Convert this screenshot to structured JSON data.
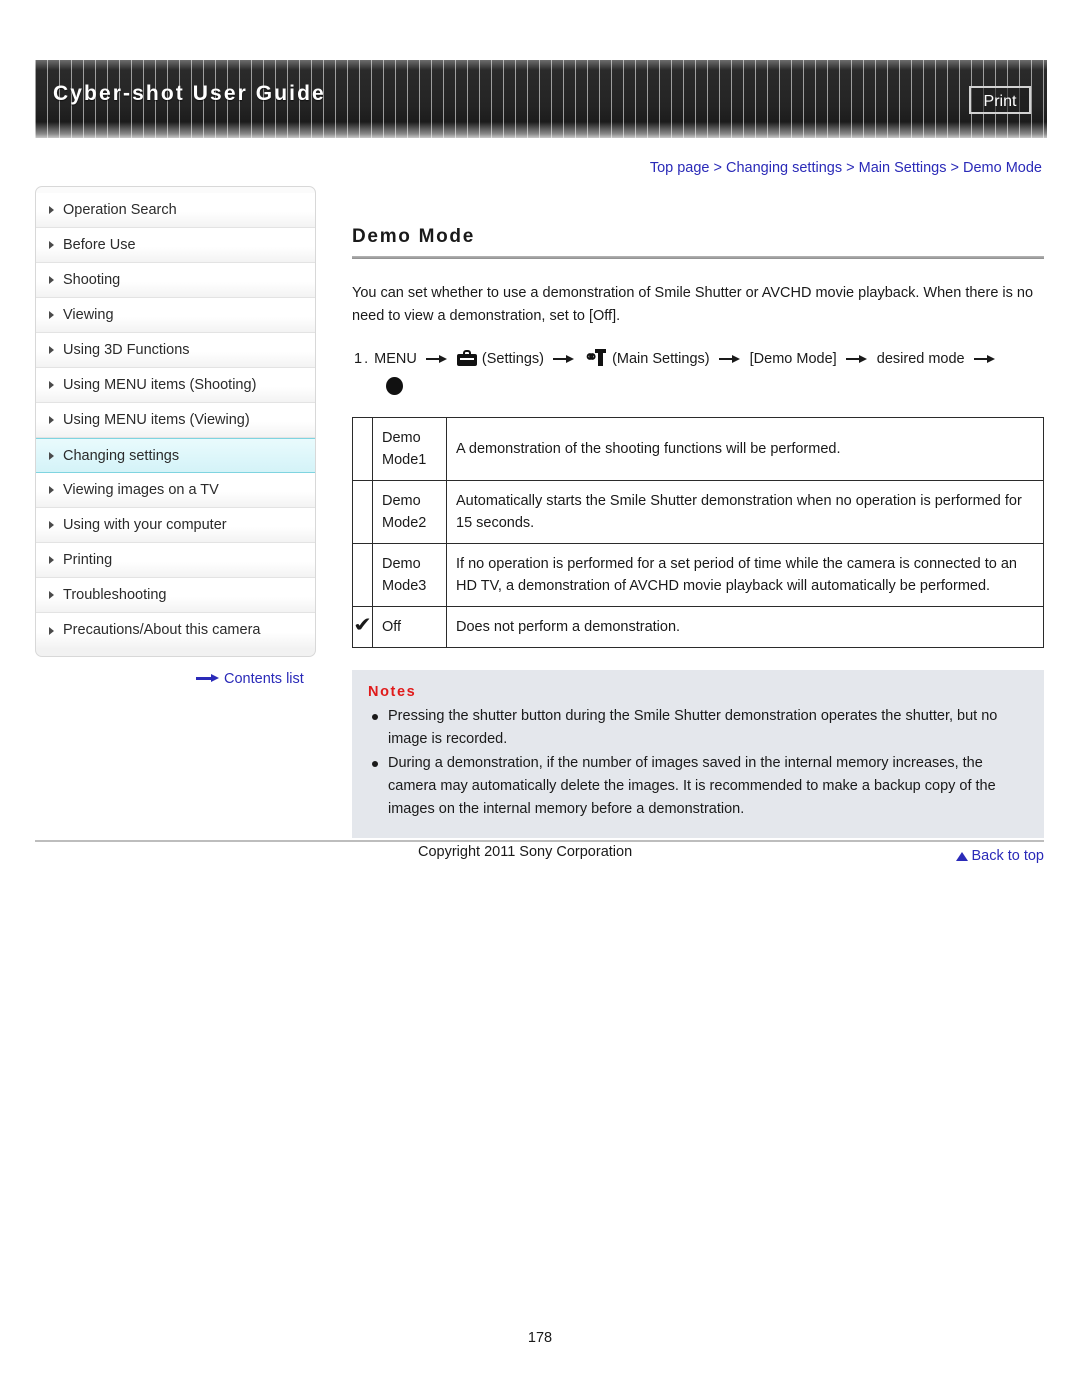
{
  "header": {
    "title": "Cyber-shot User Guide",
    "print_label": "Print"
  },
  "sidebar": {
    "items": [
      {
        "label": "Operation Search",
        "active": false
      },
      {
        "label": "Before Use",
        "active": false
      },
      {
        "label": "Shooting",
        "active": false
      },
      {
        "label": "Viewing",
        "active": false
      },
      {
        "label": "Using 3D Functions",
        "active": false
      },
      {
        "label": "Using MENU items (Shooting)",
        "active": false
      },
      {
        "label": "Using MENU items (Viewing)",
        "active": false
      },
      {
        "label": "Changing settings",
        "active": true
      },
      {
        "label": "Viewing images on a TV",
        "active": false
      },
      {
        "label": "Using with your computer",
        "active": false
      },
      {
        "label": "Printing",
        "active": false
      },
      {
        "label": "Troubleshooting",
        "active": false
      },
      {
        "label": "Precautions/About this camera",
        "active": false
      }
    ],
    "contents_list_label": "Contents list"
  },
  "breadcrumb": {
    "items": [
      "Top page",
      "Changing settings",
      "Main Settings",
      "Demo Mode"
    ],
    "separator": ">"
  },
  "main": {
    "title": "Demo Mode",
    "intro": "You can set whether to use a demonstration of Smile Shutter or AVCHD movie playback. When there is no need to view a demonstration, set to [Off].",
    "step": {
      "number": "1.",
      "menu": "MENU",
      "settings_label": "(Settings)",
      "main_settings_label": "(Main Settings)",
      "demo_mode_label": "[Demo Mode]",
      "desired_mode_label": "desired mode"
    },
    "table": {
      "rows": [
        {
          "checked": false,
          "check": "",
          "label": "Demo\nMode1",
          "description": "A demonstration of the shooting functions will be performed."
        },
        {
          "checked": false,
          "check": "",
          "label": "Demo\nMode2",
          "description": "Automatically starts the Smile Shutter demonstration when no operation is performed for 15 seconds."
        },
        {
          "checked": false,
          "check": "",
          "label": "Demo\nMode3",
          "description": "If no operation is performed for a set period of time while the camera is connected to an HD TV, a demonstration of AVCHD movie playback will automatically be performed."
        },
        {
          "checked": true,
          "check": "✔",
          "label": "Off",
          "description": "Does not perform a demonstration."
        }
      ]
    },
    "notes": {
      "title": "Notes",
      "items": [
        "Pressing the shutter button during the Smile Shutter demonstration operates the shutter, but no image is recorded.",
        "During a demonstration, if the number of images saved in the internal memory increases, the camera may automatically delete the images. It is recommended to make a backup copy of the images on the internal memory before a demonstration."
      ]
    }
  },
  "footer": {
    "back_to_top": "Back to top",
    "copyright": "Copyright 2011 Sony Corporation",
    "page_number": "178"
  },
  "colors": {
    "link": "#2a2ab8",
    "notes_title": "#e01b1b",
    "active_nav": "#d4f3f8",
    "notes_bg": "#e4e7ec"
  }
}
